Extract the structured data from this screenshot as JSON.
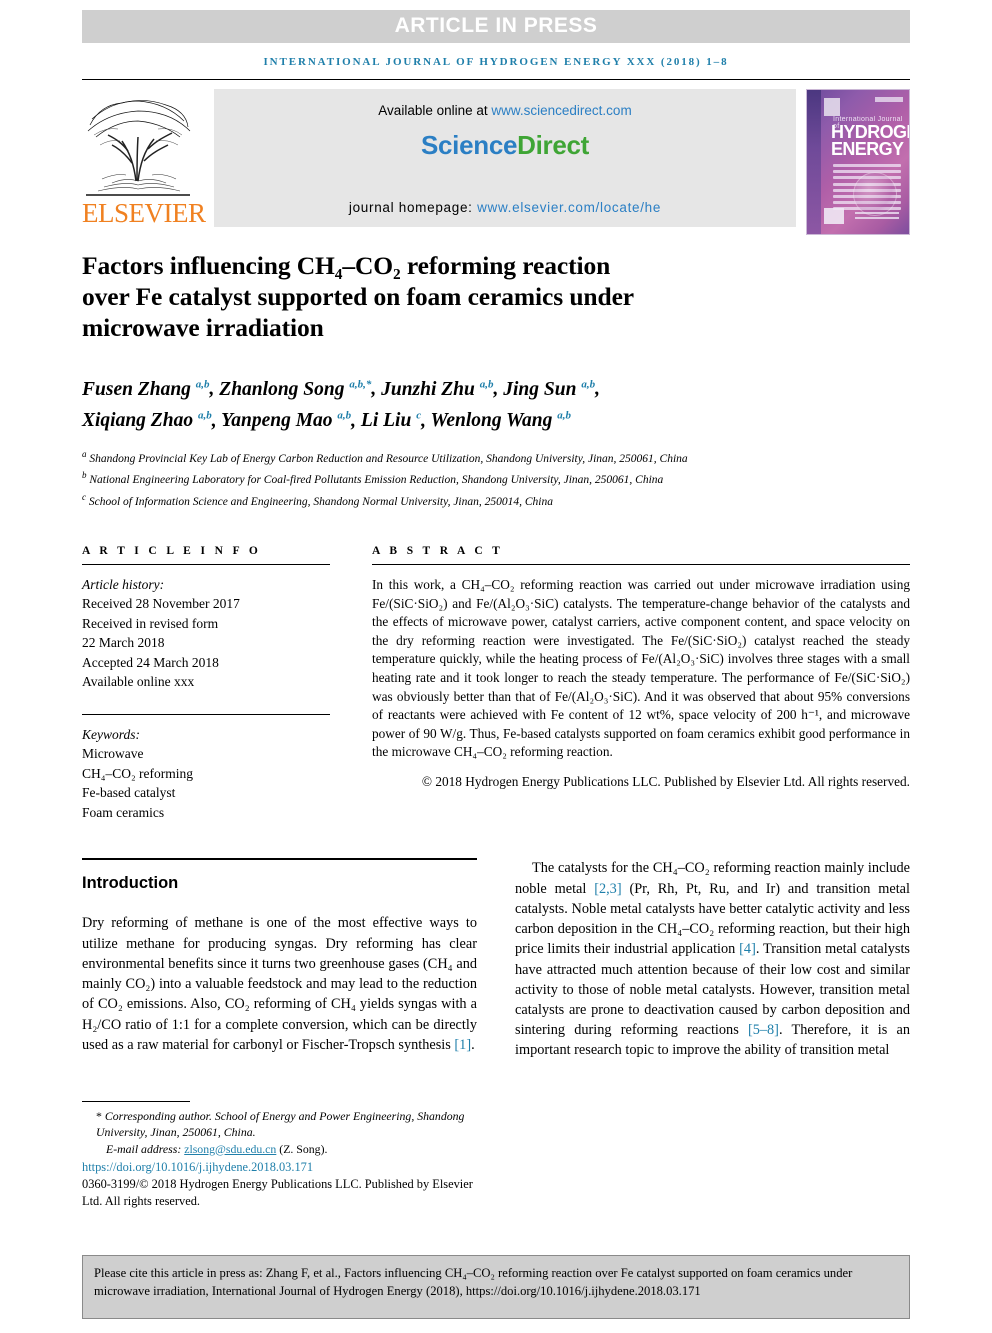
{
  "banner": {
    "text": "ARTICLE IN PRESS"
  },
  "running_head": {
    "text": "INTERNATIONAL JOURNAL OF HYDROGEN ENERGY XXX (2018) 1–8"
  },
  "masthead": {
    "publisher": "ELSEVIER",
    "available_prefix": "Available online at ",
    "available_link": "www.sciencedirect.com",
    "logo_part1": "Science",
    "logo_part2": "Direct",
    "homepage_prefix": "journal homepage: ",
    "homepage_link": "www.elsevier.com/locate/he",
    "cover": {
      "line_top": "International Journal of",
      "line_big1": "HYDROGEN",
      "line_big2": "ENERGY"
    }
  },
  "article": {
    "title_line1": "Factors influencing CH₄–CO₂ reforming reaction",
    "title_line2": "over Fe catalyst supported on foam ceramics under",
    "title_line3": "microwave irradiation",
    "authors": [
      {
        "name": "Fusen Zhang",
        "marks": "a,b",
        "sep": ", "
      },
      {
        "name": "Zhanlong Song",
        "marks": "a,b,*",
        "sep": ", "
      },
      {
        "name": "Junzhi Zhu",
        "marks": "a,b",
        "sep": ", "
      },
      {
        "name": "Jing Sun",
        "marks": "a,b",
        "sep": ", "
      },
      {
        "name": "Xiqiang Zhao",
        "marks": "a,b",
        "sep": ", "
      },
      {
        "name": "Yanpeng Mao",
        "marks": "a,b",
        "sep": ", "
      },
      {
        "name": "Li Liu",
        "marks": "c",
        "sep": ", "
      },
      {
        "name": "Wenlong Wang",
        "marks": "a,b",
        "sep": ""
      }
    ],
    "affiliations": [
      {
        "mark": "a",
        "text": "Shandong Provincial Key Lab of Energy Carbon Reduction and Resource Utilization, Shandong University, Jinan, 250061, China"
      },
      {
        "mark": "b",
        "text": "National Engineering Laboratory for Coal-fired Pollutants Emission Reduction, Shandong University, Jinan, 250061, China"
      },
      {
        "mark": "c",
        "text": "School of Information Science and Engineering, Shandong Normal University, Jinan, 250014, China"
      }
    ]
  },
  "article_info": {
    "heading": "A R T I C L E   I N F O",
    "history_label": "Article history:",
    "history": [
      "Received 28 November 2017",
      "Received in revised form",
      "22 March 2018",
      "Accepted 24 March 2018",
      "Available online xxx"
    ],
    "keywords_label": "Keywords:",
    "keywords": [
      "Microwave",
      "CH₄–CO₂ reforming",
      "Fe-based catalyst",
      "Foam ceramics"
    ]
  },
  "abstract": {
    "heading": "A B S T R A C T",
    "text": "In this work, a CH₄–CO₂ reforming reaction was carried out under microwave irradiation using Fe/(SiC·SiO₂) and Fe/(Al₂O₃·SiC) catalysts. The temperature-change behavior of the catalysts and the effects of microwave power, catalyst carriers, active component content, and space velocity on the dry reforming reaction were investigated. The Fe/(SiC·SiO₂) catalyst reached the steady temperature quickly, while the heating process of Fe/(Al₂O₃·SiC) involves three stages with a small heating rate and it took longer to reach the steady temperature. The performance of Fe/(SiC·SiO₂) was obviously better than that of Fe/(Al₂O₃·SiC). And it was observed that about 95% conversions of reactants were achieved with Fe content of 12 wt%, space velocity of 200 h⁻¹, and microwave power of 90 W/g. Thus, Fe-based catalysts supported on foam ceramics exhibit good performance in the microwave CH₄–CO₂ reforming reaction.",
    "copyright": "© 2018 Hydrogen Energy Publications LLC. Published by Elsevier Ltd. All rights reserved."
  },
  "introduction": {
    "heading": "Introduction",
    "left_paragraph": "Dry reforming of methane is one of the most effective ways to utilize methane for producing syngas. Dry reforming has clear environmental benefits since it turns two greenhouse gases (CH₄ and mainly CO₂) into a valuable feedstock and may lead to the reduction of CO₂ emissions. Also, CO₂ reforming of CH₄ yields syngas with a H₂/CO ratio of 1:1 for a complete conversion, which can be directly used as a raw material for carbonyl or Fischer-Tropsch synthesis ",
    "left_ref": "[1]",
    "left_tail": ".",
    "right_p1_a": "The catalysts for the CH₄–CO₂ reforming reaction mainly include noble metal ",
    "right_ref1": "[2,3]",
    "right_p1_b": " (Pr, Rh, Pt, Ru, and Ir) and transition metal catalysts. Noble metal catalysts have better catalytic activity and less carbon deposition in the CH₄–CO₂ reforming reaction, but their high price limits their industrial application ",
    "right_ref2": "[4]",
    "right_p1_c": ". Transition metal catalysts have attracted much attention because of their low cost and similar activity to those of noble metal catalysts. However, transition metal catalysts are prone to deactivation caused by carbon deposition and sintering during reforming reactions ",
    "right_ref3": "[5–8]",
    "right_p1_d": ". Therefore, it is an important research topic to improve the ability of transition metal"
  },
  "footnotes": {
    "corresponding_star": "*",
    "corresponding_text": " Corresponding author. School of Energy and Power Engineering, Shandong University, Jinan, 250061, China.",
    "email_label": "E-mail address: ",
    "email_link": "zlsong@sdu.edu.cn",
    "email_suffix": " (Z. Song).",
    "doi": "https://doi.org/10.1016/j.ijhydene.2018.03.171",
    "issn": "0360-3199/© 2018 Hydrogen Energy Publications LLC. Published by Elsevier Ltd. All rights reserved."
  },
  "citation_box": {
    "text": "Please cite this article in press as: Zhang F, et al., Factors influencing CH₄–CO₂ reforming reaction over Fe catalyst supported on foam ceramics under microwave irradiation, International Journal of Hydrogen Energy (2018), https://doi.org/10.1016/j.ijhydene.2018.03.171"
  },
  "colors": {
    "banner_gray": "#cfcfcf",
    "journal_blue": "#1f7faa",
    "link_blue": "#2b7fc4",
    "sciencedirect_green": "#3fa535",
    "elsevier_orange": "#f08121"
  }
}
